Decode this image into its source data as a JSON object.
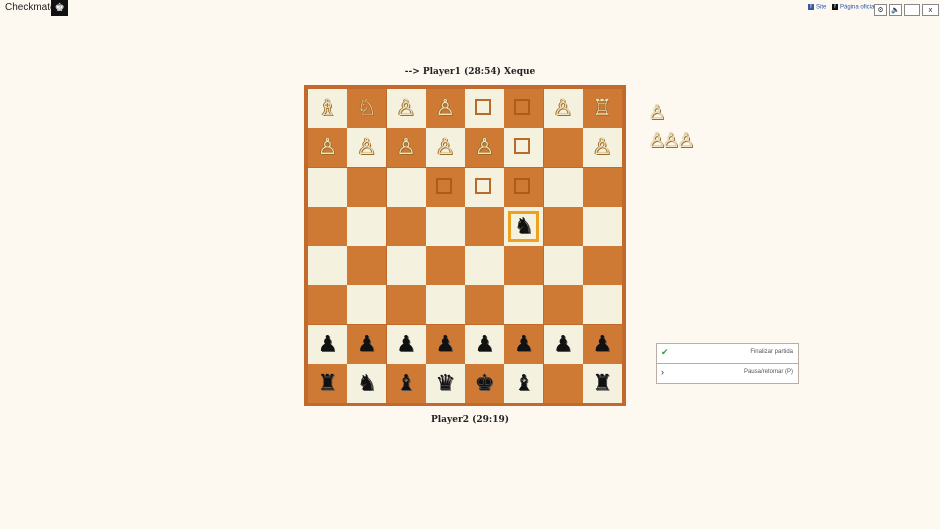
{
  "app": {
    "title": "Checkmate!",
    "logo_icon": "chess-king-icon"
  },
  "topbar": {
    "site_label": "Site",
    "page_label": "Página oficial",
    "fb_glyph": "f",
    "close_glyph": "x"
  },
  "status_top": "--> Player1 (28:54)  Xeque",
  "status_bottom": "Player2 (29:19)",
  "board": {
    "rows": [
      [
        "wB",
        "wN",
        "wP",
        "wP",
        "mark",
        "mark",
        "wP",
        "wR"
      ],
      [
        "wP",
        "wP",
        "wP",
        "wP",
        "wP",
        "mark",
        "",
        "wP"
      ],
      [
        "",
        "",
        "",
        "mark",
        "mark",
        "mark",
        "",
        ""
      ],
      [
        "",
        "",
        "",
        "",
        "",
        "selbN",
        "",
        ""
      ],
      [
        "",
        "",
        "",
        "",
        "",
        "",
        "",
        ""
      ],
      [
        "",
        "",
        "",
        "",
        "",
        "",
        "",
        ""
      ],
      [
        "bP",
        "bP",
        "bP",
        "bP",
        "bP",
        "bP",
        "bP",
        "bP"
      ],
      [
        "bR",
        "bN",
        "bB",
        "bQ",
        "bK",
        "bB",
        "",
        "bR"
      ]
    ],
    "colors": {
      "light": "#f5f1df",
      "dark": "#cf7a34",
      "frame": "#c26a2c",
      "selected": "#f0a020"
    }
  },
  "captured": {
    "pieces": [
      "wP",
      "wP",
      "wP",
      "wP"
    ]
  },
  "glyphs": {
    "wK": "♔",
    "wQ": "♕",
    "wR": "♖",
    "wB": "♗",
    "wN": "♘",
    "wP": "♙",
    "bK": "♚",
    "bQ": "♛",
    "bR": "♜",
    "bB": "♝",
    "bN": "♞",
    "bP": "♟"
  },
  "actions": {
    "finish_label": "Finalizar partida",
    "finish_icon": "check-icon",
    "pause_label": "Pausa/retomar (P)",
    "pause_icon": "chevron-right-icon"
  }
}
